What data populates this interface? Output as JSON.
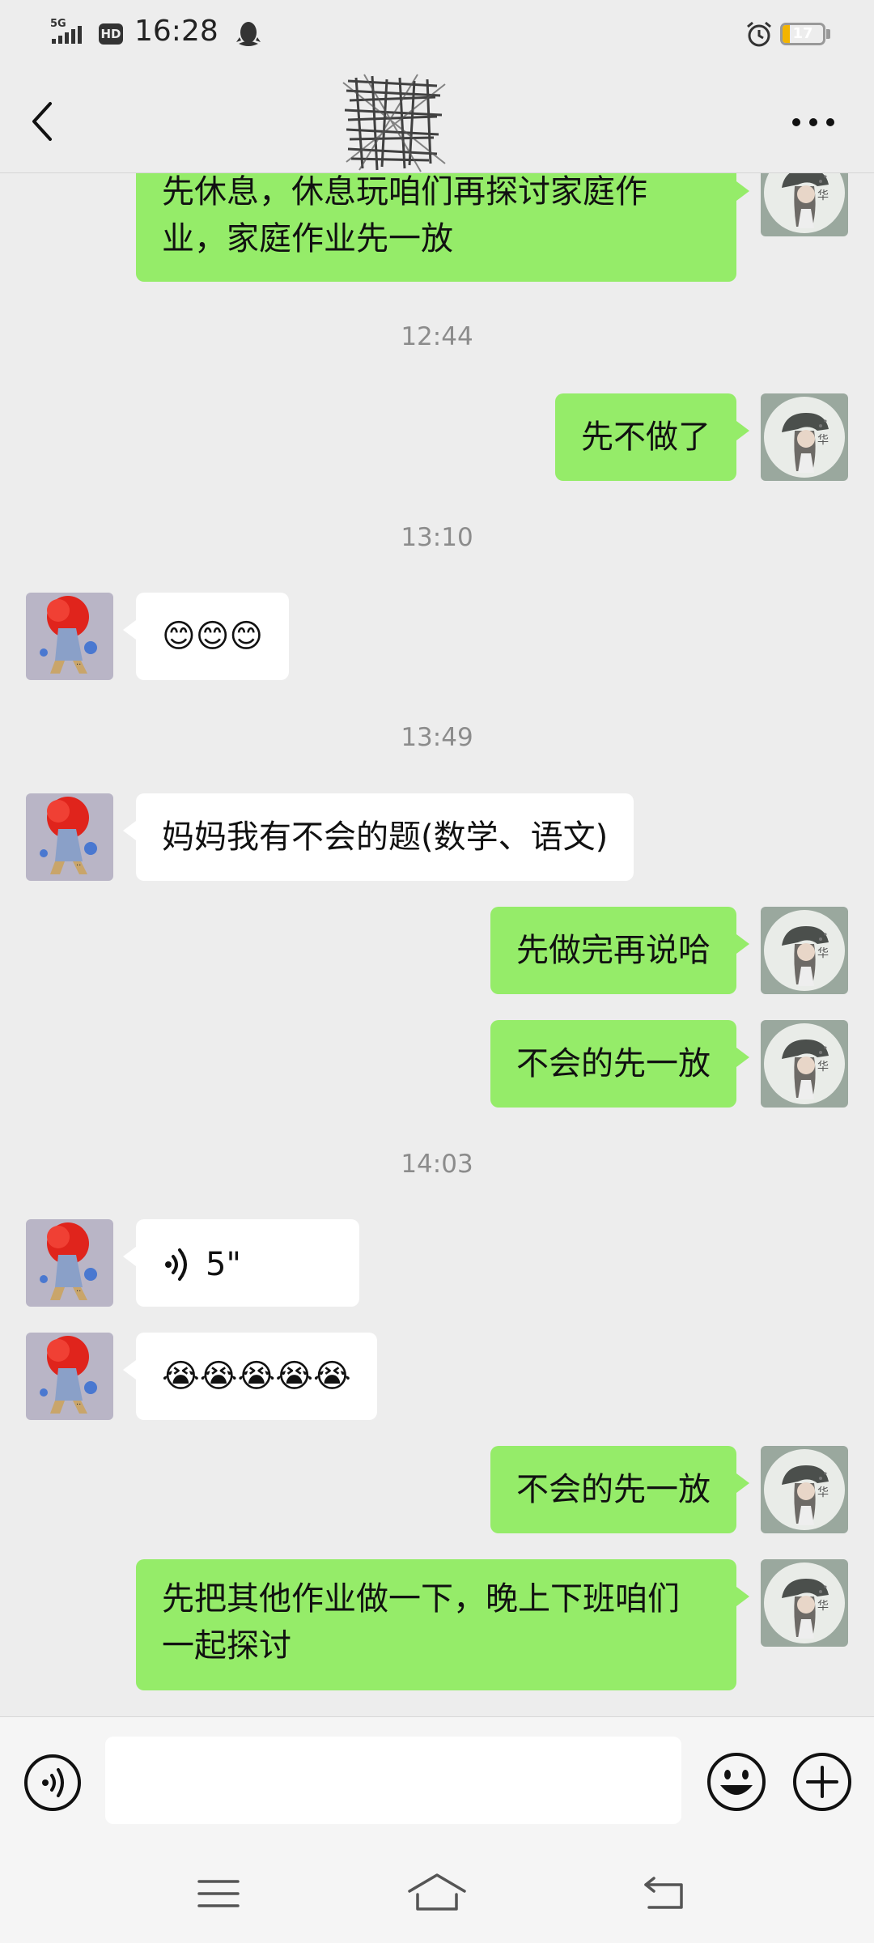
{
  "status_bar": {
    "network": "5G",
    "hd": "HD",
    "time": "16:28",
    "battery_level": "17",
    "icons": [
      "signal-icon",
      "hd-icon",
      "qq-icon",
      "alarm-icon",
      "battery-icon"
    ],
    "battery_fill_fraction": 0.17,
    "battery_color": "#f3b400"
  },
  "nav": {
    "title_obscured": true,
    "back_icon": "chevron-left-icon",
    "more_icon": "more-dots-icon"
  },
  "colors": {
    "background": "#ededed",
    "my_bubble": "#95ec69",
    "their_bubble": "#ffffff",
    "timestamp_text": "#8c8c8c"
  },
  "chat": {
    "timestamps": [
      "12:44",
      "13:10",
      "13:49",
      "14:03"
    ],
    "messages": [
      {
        "from": "me",
        "text": "先休息，休息玩咱们再探讨家庭作业，家庭作业先一放"
      },
      {
        "from": "me",
        "text": "先不做了"
      },
      {
        "from": "them",
        "text": "😊😊😊"
      },
      {
        "from": "them",
        "text": "妈妈我有不会的题(数学、语文)"
      },
      {
        "from": "me",
        "text": "先做完再说哈"
      },
      {
        "from": "me",
        "text": "不会的先一放"
      },
      {
        "from": "them",
        "type": "voice",
        "text": "5\""
      },
      {
        "from": "them",
        "text": "😭😭😭😭😭"
      },
      {
        "from": "me",
        "text": "不会的先一放"
      },
      {
        "from": "me",
        "text": "先把其他作业做一下，晚上下班咱们一起探讨"
      }
    ]
  },
  "input_bar": {
    "value": "",
    "icons": [
      "voice-input-icon",
      "emoji-icon",
      "plus-icon"
    ]
  },
  "system_nav": {
    "icons": [
      "menu-icon",
      "home-icon",
      "back-icon"
    ]
  }
}
